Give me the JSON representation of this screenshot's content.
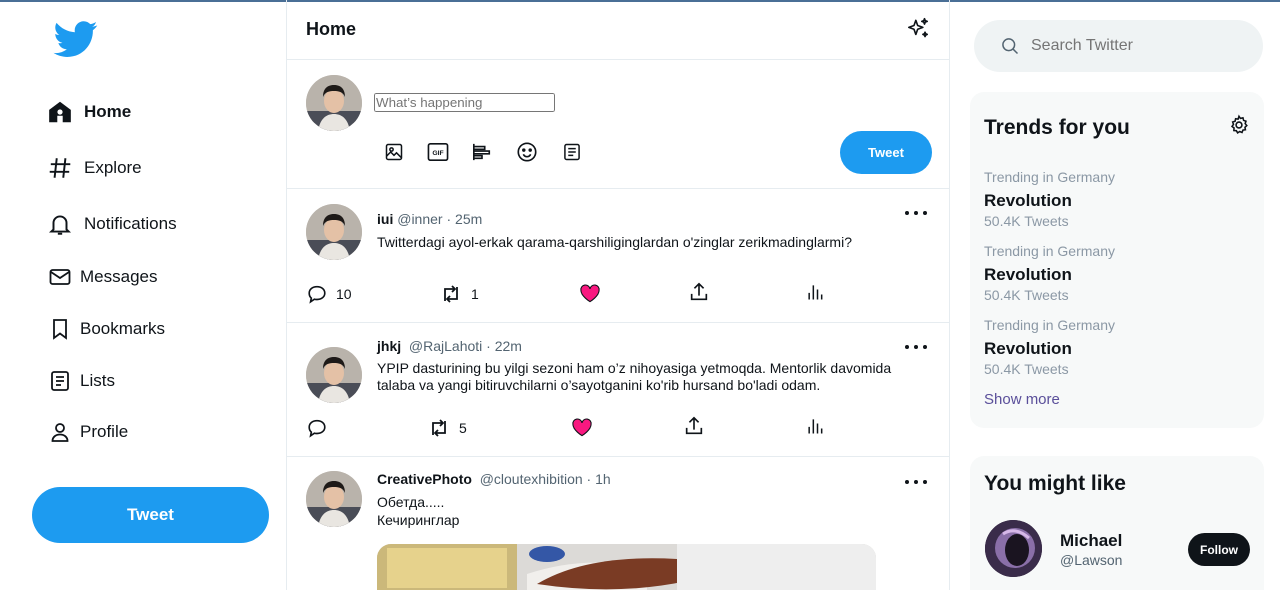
{
  "nav": {
    "items": [
      {
        "label": "Home",
        "icon": "home-icon"
      },
      {
        "label": "Explore",
        "icon": "hashtag-icon"
      },
      {
        "label": "Notifications",
        "icon": "bell-icon"
      },
      {
        "label": "Messages",
        "icon": "envelope-icon"
      },
      {
        "label": "Bookmarks",
        "icon": "bookmark-icon"
      },
      {
        "label": "Lists",
        "icon": "list-icon"
      },
      {
        "label": "Profile",
        "icon": "person-icon"
      }
    ],
    "tweet_button": "Tweet"
  },
  "main": {
    "title": "Home",
    "composer": {
      "placeholder": "What’s happening",
      "tweet_button": "Tweet",
      "tools": [
        "image-icon",
        "gif-icon",
        "poll-icon",
        "emoji-icon",
        "schedule-icon"
      ]
    },
    "tweets": [
      {
        "name": "iui",
        "handle": "@inner",
        "time": "25m",
        "text": "Twitterdagi ayol-erkak qarama-qarshiliginglardan o'zinglar zerikmadinglarmi?",
        "replies": "10",
        "retweets": "1"
      },
      {
        "name": "jhkj",
        "handle": "@RajLahoti",
        "time": "22m",
        "text": "YPIP dasturining bu yilgi sezoni ham o’z nihoyasiga yetmoqda. Mentorlik davomida talaba va yangi bitiruvchilarni o’sayotganini ko'rib hursand bo'ladi odam.",
        "replies": "",
        "retweets": "5"
      },
      {
        "name": "CreativePhoto",
        "handle": "@cloutexhibition",
        "time": "1h",
        "text_line1": "Обетда.....",
        "text_line2": "Кечиринглар"
      }
    ]
  },
  "right": {
    "search_placeholder": "Search Twitter",
    "trends_title": "Trends for you",
    "trends": [
      {
        "meta": "Trending in Germany",
        "topic": "Revolution",
        "count": "50.4K Tweets"
      },
      {
        "meta": "Trending in Germany",
        "topic": "Revolution",
        "count": "50.4K Tweets"
      },
      {
        "meta": "Trending in Germany",
        "topic": "Revolution",
        "count": "50.4K Tweets"
      }
    ],
    "show_more": "Show more",
    "follow_title": "You might like",
    "follow": {
      "name": "Michael",
      "handle": "@Lawson",
      "button": "Follow"
    }
  },
  "colors": {
    "accent": "#1d9bf0",
    "like": "#f91880",
    "text": "#0f1419",
    "muted": "#536471"
  }
}
